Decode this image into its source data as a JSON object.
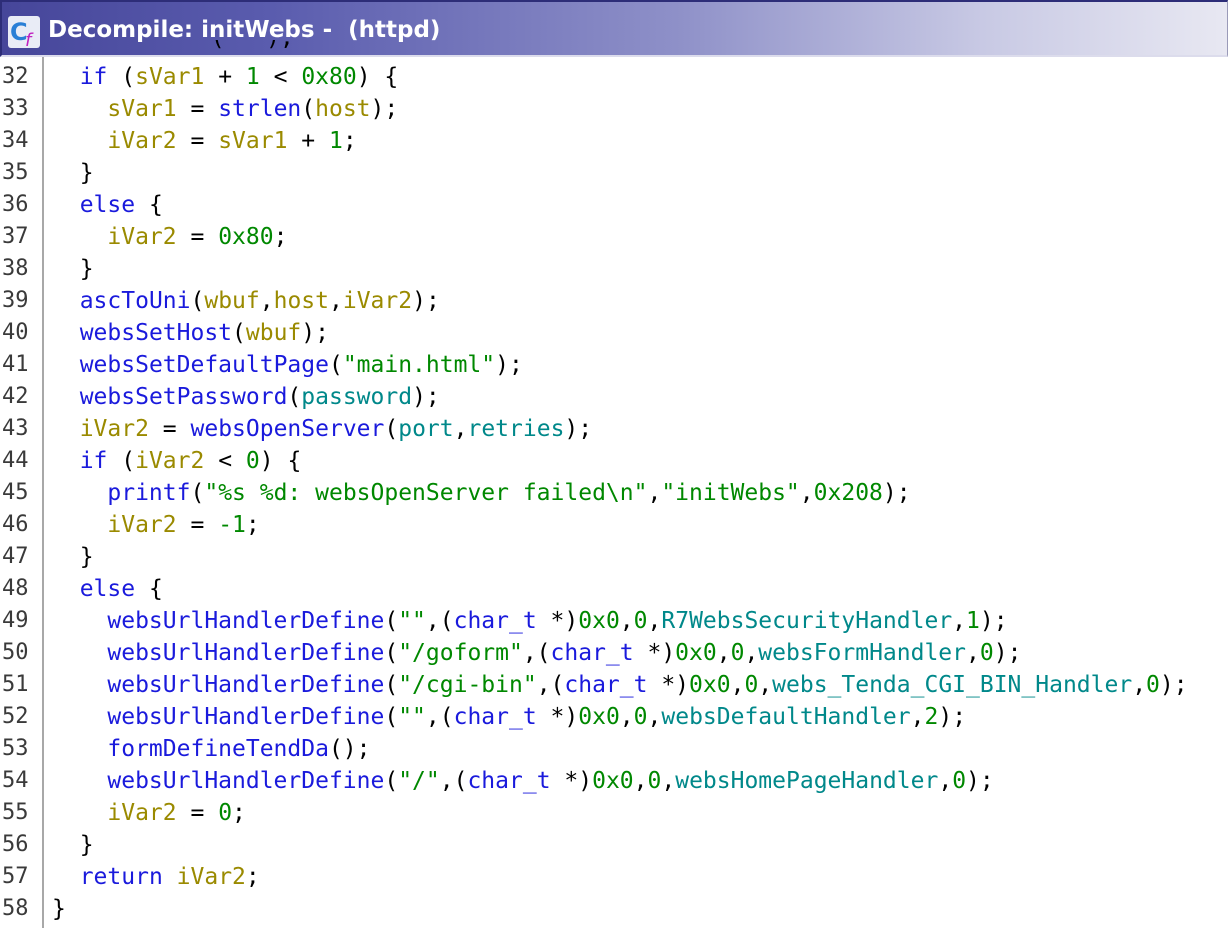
{
  "window": {
    "title": "Decompile: initWebs -  (httpd)",
    "icon": "ghidra-decompiler-icon"
  },
  "editor": {
    "peek_text": "        (   );",
    "lines": [
      {
        "no": "32",
        "tokens": [
          [
            "op",
            "  "
          ],
          [
            "kw",
            "if"
          ],
          [
            "op",
            " ("
          ],
          [
            "var",
            "sVar1"
          ],
          [
            "op",
            " + "
          ],
          [
            "num",
            "1"
          ],
          [
            "op",
            " < "
          ],
          [
            "num",
            "0x80"
          ],
          [
            "op",
            ") {"
          ]
        ]
      },
      {
        "no": "33",
        "tokens": [
          [
            "op",
            "    "
          ],
          [
            "var",
            "sVar1"
          ],
          [
            "op",
            " = "
          ],
          [
            "fn",
            "strlen"
          ],
          [
            "op",
            "("
          ],
          [
            "var",
            "host"
          ],
          [
            "op",
            ");"
          ]
        ]
      },
      {
        "no": "34",
        "tokens": [
          [
            "op",
            "    "
          ],
          [
            "var",
            "iVar2"
          ],
          [
            "op",
            " = "
          ],
          [
            "var",
            "sVar1"
          ],
          [
            "op",
            " + "
          ],
          [
            "num",
            "1"
          ],
          [
            "op",
            ";"
          ]
        ]
      },
      {
        "no": "35",
        "tokens": [
          [
            "op",
            "  }"
          ]
        ]
      },
      {
        "no": "36",
        "tokens": [
          [
            "op",
            "  "
          ],
          [
            "kw",
            "else"
          ],
          [
            "op",
            " {"
          ]
        ]
      },
      {
        "no": "37",
        "tokens": [
          [
            "op",
            "    "
          ],
          [
            "var",
            "iVar2"
          ],
          [
            "op",
            " = "
          ],
          [
            "num",
            "0x80"
          ],
          [
            "op",
            ";"
          ]
        ]
      },
      {
        "no": "38",
        "tokens": [
          [
            "op",
            "  }"
          ]
        ]
      },
      {
        "no": "39",
        "tokens": [
          [
            "op",
            "  "
          ],
          [
            "fn",
            "ascToUni"
          ],
          [
            "op",
            "("
          ],
          [
            "var",
            "wbuf"
          ],
          [
            "op",
            ","
          ],
          [
            "var",
            "host"
          ],
          [
            "op",
            ","
          ],
          [
            "var",
            "iVar2"
          ],
          [
            "op",
            ");"
          ]
        ]
      },
      {
        "no": "40",
        "tokens": [
          [
            "op",
            "  "
          ],
          [
            "fn",
            "websSetHost"
          ],
          [
            "op",
            "("
          ],
          [
            "var",
            "wbuf"
          ],
          [
            "op",
            ");"
          ]
        ]
      },
      {
        "no": "41",
        "tokens": [
          [
            "op",
            "  "
          ],
          [
            "fn",
            "websSetDefaultPage"
          ],
          [
            "op",
            "("
          ],
          [
            "str",
            "\"main.html\""
          ],
          [
            "op",
            ");"
          ]
        ]
      },
      {
        "no": "42",
        "tokens": [
          [
            "op",
            "  "
          ],
          [
            "fn",
            "websSetPassword"
          ],
          [
            "op",
            "("
          ],
          [
            "param",
            "password"
          ],
          [
            "op",
            ");"
          ]
        ]
      },
      {
        "no": "43",
        "tokens": [
          [
            "op",
            "  "
          ],
          [
            "var",
            "iVar2"
          ],
          [
            "op",
            " = "
          ],
          [
            "fn",
            "websOpenServer"
          ],
          [
            "op",
            "("
          ],
          [
            "param",
            "port"
          ],
          [
            "op",
            ","
          ],
          [
            "param",
            "retries"
          ],
          [
            "op",
            ");"
          ]
        ]
      },
      {
        "no": "44",
        "tokens": [
          [
            "op",
            "  "
          ],
          [
            "kw",
            "if"
          ],
          [
            "op",
            " ("
          ],
          [
            "var",
            "iVar2"
          ],
          [
            "op",
            " < "
          ],
          [
            "num",
            "0"
          ],
          [
            "op",
            ") {"
          ]
        ]
      },
      {
        "no": "45",
        "tokens": [
          [
            "op",
            "    "
          ],
          [
            "fn",
            "printf"
          ],
          [
            "op",
            "("
          ],
          [
            "str",
            "\"%s %d: websOpenServer failed\\n\""
          ],
          [
            "op",
            ","
          ],
          [
            "str",
            "\"initWebs\""
          ],
          [
            "op",
            ","
          ],
          [
            "num",
            "0x208"
          ],
          [
            "op",
            ");"
          ]
        ]
      },
      {
        "no": "46",
        "tokens": [
          [
            "op",
            "    "
          ],
          [
            "var",
            "iVar2"
          ],
          [
            "op",
            " = "
          ],
          [
            "num",
            "-1"
          ],
          [
            "op",
            ";"
          ]
        ]
      },
      {
        "no": "47",
        "tokens": [
          [
            "op",
            "  }"
          ]
        ]
      },
      {
        "no": "48",
        "tokens": [
          [
            "op",
            "  "
          ],
          [
            "kw",
            "else"
          ],
          [
            "op",
            " {"
          ]
        ]
      },
      {
        "no": "49",
        "tokens": [
          [
            "op",
            "    "
          ],
          [
            "fn",
            "websUrlHandlerDefine"
          ],
          [
            "op",
            "("
          ],
          [
            "str",
            "\"\""
          ],
          [
            "op",
            ",("
          ],
          [
            "type",
            "char_t"
          ],
          [
            "op",
            " *)"
          ],
          [
            "num",
            "0x0"
          ],
          [
            "op",
            ","
          ],
          [
            "num",
            "0"
          ],
          [
            "op",
            ","
          ],
          [
            "param",
            "R7WebsSecurityHandler"
          ],
          [
            "op",
            ","
          ],
          [
            "num",
            "1"
          ],
          [
            "op",
            ");"
          ]
        ]
      },
      {
        "no": "50",
        "tokens": [
          [
            "op",
            "    "
          ],
          [
            "fn",
            "websUrlHandlerDefine"
          ],
          [
            "op",
            "("
          ],
          [
            "str",
            "\"/goform\""
          ],
          [
            "op",
            ",("
          ],
          [
            "type",
            "char_t"
          ],
          [
            "op",
            " *)"
          ],
          [
            "num",
            "0x0"
          ],
          [
            "op",
            ","
          ],
          [
            "num",
            "0"
          ],
          [
            "op",
            ","
          ],
          [
            "param",
            "websFormHandler"
          ],
          [
            "op",
            ","
          ],
          [
            "num",
            "0"
          ],
          [
            "op",
            ");"
          ]
        ]
      },
      {
        "no": "51",
        "tokens": [
          [
            "op",
            "    "
          ],
          [
            "fn",
            "websUrlHandlerDefine"
          ],
          [
            "op",
            "("
          ],
          [
            "str",
            "\"/cgi-bin\""
          ],
          [
            "op",
            ",("
          ],
          [
            "type",
            "char_t"
          ],
          [
            "op",
            " *)"
          ],
          [
            "num",
            "0x0"
          ],
          [
            "op",
            ","
          ],
          [
            "num",
            "0"
          ],
          [
            "op",
            ","
          ],
          [
            "param",
            "webs_Tenda_CGI_BIN_Handler"
          ],
          [
            "op",
            ","
          ],
          [
            "num",
            "0"
          ],
          [
            "op",
            ");"
          ]
        ]
      },
      {
        "no": "52",
        "tokens": [
          [
            "op",
            "    "
          ],
          [
            "fn",
            "websUrlHandlerDefine"
          ],
          [
            "op",
            "("
          ],
          [
            "str",
            "\"\""
          ],
          [
            "op",
            ",("
          ],
          [
            "type",
            "char_t"
          ],
          [
            "op",
            " *)"
          ],
          [
            "num",
            "0x0"
          ],
          [
            "op",
            ","
          ],
          [
            "num",
            "0"
          ],
          [
            "op",
            ","
          ],
          [
            "param",
            "websDefaultHandler"
          ],
          [
            "op",
            ","
          ],
          [
            "num",
            "2"
          ],
          [
            "op",
            ");"
          ]
        ]
      },
      {
        "no": "53",
        "tokens": [
          [
            "op",
            "    "
          ],
          [
            "fn",
            "formDefineTendDa"
          ],
          [
            "op",
            "();"
          ]
        ]
      },
      {
        "no": "54",
        "tokens": [
          [
            "op",
            "    "
          ],
          [
            "fn",
            "websUrlHandlerDefine"
          ],
          [
            "op",
            "("
          ],
          [
            "str",
            "\"/\""
          ],
          [
            "op",
            ",("
          ],
          [
            "type",
            "char_t"
          ],
          [
            "op",
            " *)"
          ],
          [
            "num",
            "0x0"
          ],
          [
            "op",
            ","
          ],
          [
            "num",
            "0"
          ],
          [
            "op",
            ","
          ],
          [
            "param",
            "websHomePageHandler"
          ],
          [
            "op",
            ","
          ],
          [
            "num",
            "0"
          ],
          [
            "op",
            ");"
          ]
        ]
      },
      {
        "no": "55",
        "tokens": [
          [
            "op",
            "    "
          ],
          [
            "var",
            "iVar2"
          ],
          [
            "op",
            " = "
          ],
          [
            "num",
            "0"
          ],
          [
            "op",
            ";"
          ]
        ]
      },
      {
        "no": "56",
        "tokens": [
          [
            "op",
            "  }"
          ]
        ]
      },
      {
        "no": "57",
        "tokens": [
          [
            "op",
            "  "
          ],
          [
            "kw",
            "return"
          ],
          [
            "op",
            " "
          ],
          [
            "var",
            "iVar2"
          ],
          [
            "op",
            ";"
          ]
        ]
      },
      {
        "no": "58",
        "tokens": [
          [
            "op",
            "}"
          ]
        ]
      }
    ]
  }
}
